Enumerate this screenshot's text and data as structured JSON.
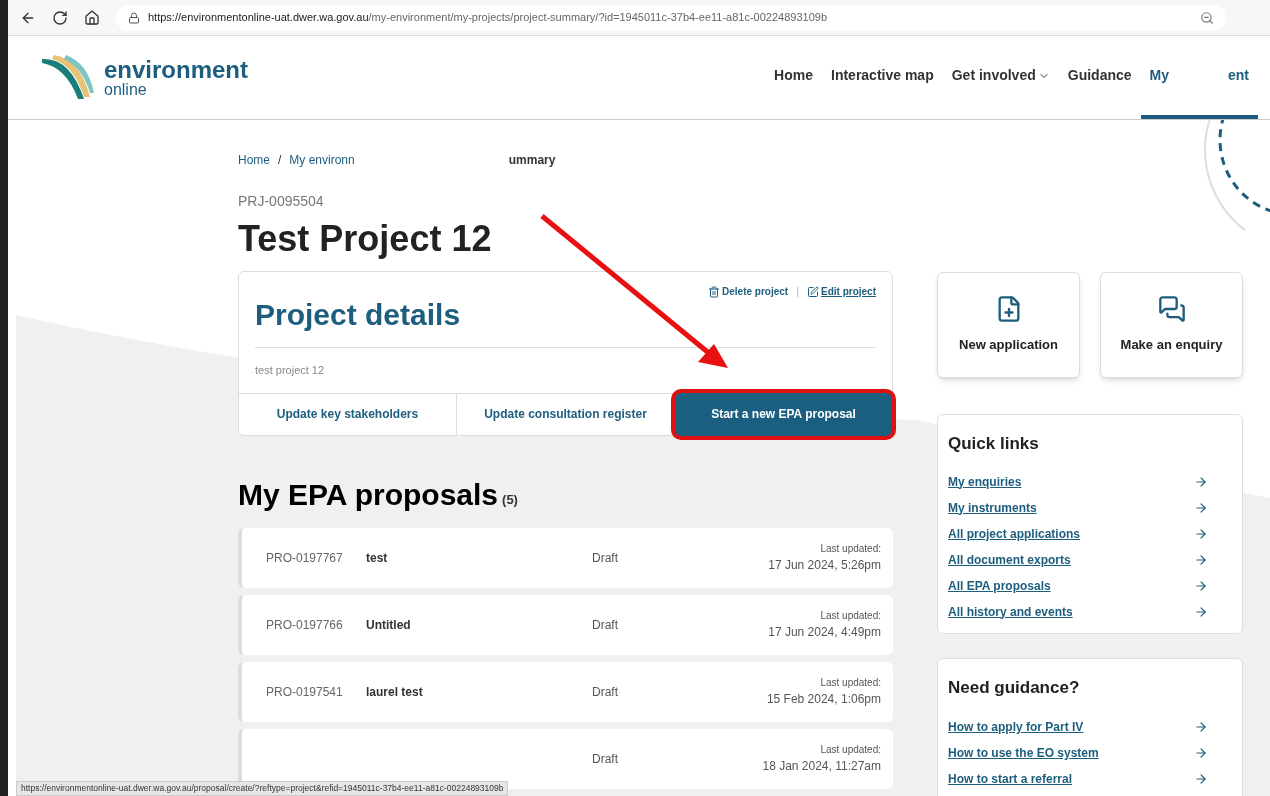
{
  "browser": {
    "url_host": "https://environmentonline-uat.dwer.wa.gov.au",
    "url_path": "/my-environment/my-projects/project-summary/?id=1945011c-37b4-ee11-a81c-00224893109b",
    "status_url": "https://environmentonline-uat.dwer.wa.gov.au/proposal/create/?reftype=project&refid=1945011c-37b4-ee11-a81c-00224893109b"
  },
  "logo": {
    "line1": "environment",
    "line2": "online"
  },
  "nav": [
    {
      "label": "Home",
      "selected": false,
      "dropdown": false
    },
    {
      "label": "Interactive map",
      "selected": false,
      "dropdown": false
    },
    {
      "label": "Get involved",
      "selected": false,
      "dropdown": true
    },
    {
      "label": "Guidance",
      "selected": false,
      "dropdown": false
    },
    {
      "label": "My",
      "selected": true,
      "dropdown": false
    },
    {
      "label": "ent",
      "selected": true,
      "dropdown": false
    }
  ],
  "breadcrumb": [
    "Home",
    "My environn",
    "ummary"
  ],
  "breadcrumb_separator": "/",
  "link_separator": "|",
  "project": {
    "id": "PRJ-0095504",
    "title": "Test Project 12"
  },
  "details": {
    "title": "Project details",
    "delete": "Delete project",
    "edit": "Edit project",
    "description": "test project 12",
    "actions": [
      {
        "label": "Update key stakeholders",
        "highlighted": false
      },
      {
        "label": "Update consultation register",
        "highlighted": false
      },
      {
        "label": "Start a new EPA proposal",
        "highlighted": true
      }
    ]
  },
  "proposals": {
    "title": "My EPA proposals",
    "count": "(5)",
    "rows": [
      {
        "id": "PRO-0197767",
        "name": "test",
        "status": "Draft",
        "updated_label": "Last updated:",
        "updated": "17 Jun 2024, 5:26pm"
      },
      {
        "id": "PRO-0197766",
        "name": "Untitled",
        "status": "Draft",
        "updated_label": "Last updated:",
        "updated": "17 Jun 2024, 4:49pm"
      },
      {
        "id": "PRO-0197541",
        "name": "laurel test",
        "status": "Draft",
        "updated_label": "Last updated:",
        "updated": "15 Feb 2024, 1:06pm"
      },
      {
        "status": "Draft",
        "updated_label": "Last updated:",
        "updated": "18 Jan 2024, 11:27am"
      }
    ]
  },
  "tiles": [
    {
      "kind": "application",
      "label": "New application"
    },
    {
      "kind": "enquiry",
      "label": "Make an enquiry"
    }
  ],
  "quick_links": {
    "title": "Quick links",
    "items": [
      "My enquiries",
      "My instruments",
      "All project applications",
      "All document exports",
      "All EPA proposals",
      "All history and events"
    ]
  },
  "guidance": {
    "title": "Need guidance?",
    "items": [
      "How to apply for Part IV",
      "How to use the EO system",
      "How to start a referral"
    ]
  }
}
